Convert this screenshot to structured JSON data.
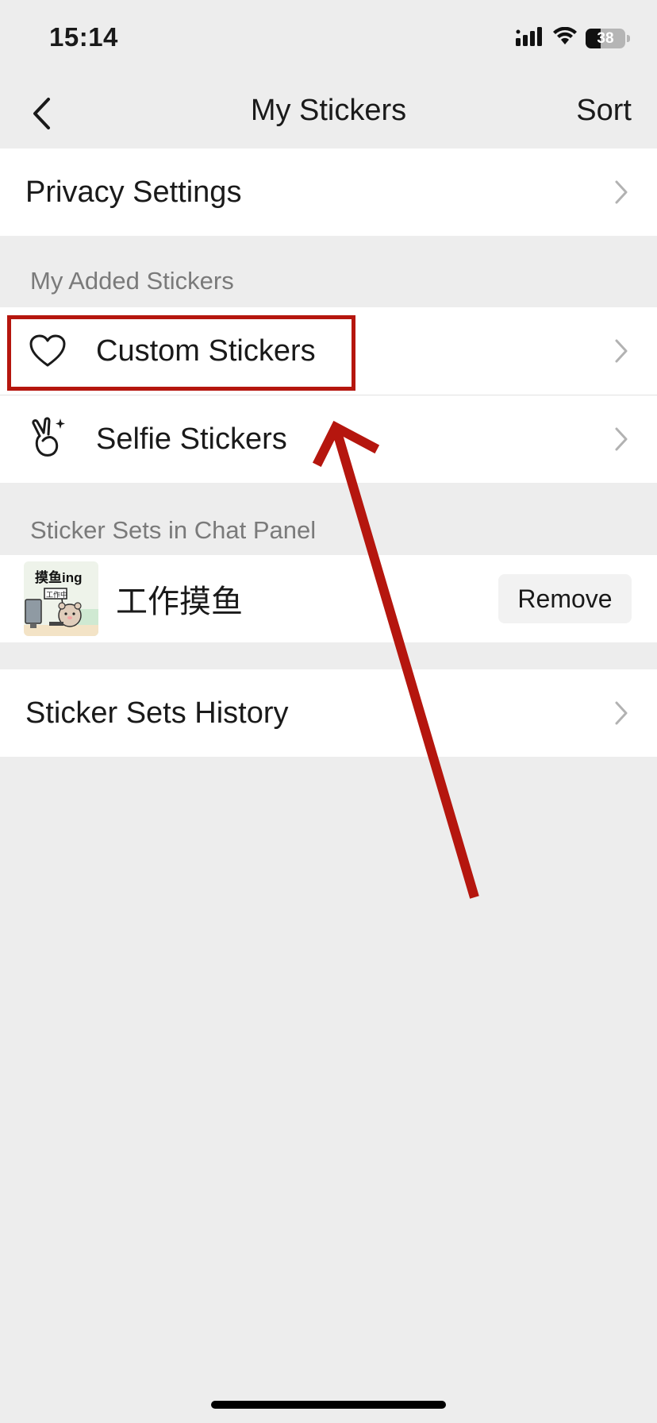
{
  "status_bar": {
    "time": "15:14",
    "battery_level": "38",
    "battery_fraction": 0.38,
    "icons": [
      "cellular-signal-icon",
      "wifi-icon",
      "battery-icon"
    ]
  },
  "nav": {
    "title": "My Stickers",
    "back_icon": "chevron-left-icon",
    "sort_label": "Sort"
  },
  "privacy_settings": {
    "label": "Privacy Settings"
  },
  "my_added_stickers": {
    "header": "My Added Stickers",
    "items": [
      {
        "label": "Custom Stickers",
        "icon": "heart-icon"
      },
      {
        "label": "Selfie Stickers",
        "icon": "victory-hand-sparkle-icon"
      }
    ]
  },
  "sticker_sets_in_chat_panel": {
    "header": "Sticker Sets in Chat Panel",
    "sets": [
      {
        "thumbnail_title": "摸鱼ing",
        "thumbnail_sign": "工作中",
        "name": "工作摸鱼",
        "action_label": "Remove"
      }
    ]
  },
  "history": {
    "label": "Sticker Sets History"
  },
  "colors": {
    "background": "#ededed",
    "row_background": "#ffffff",
    "section_header_text": "#7a7a7a",
    "annotation_red": "#b5160e",
    "chevron": "#b2b2b2"
  }
}
